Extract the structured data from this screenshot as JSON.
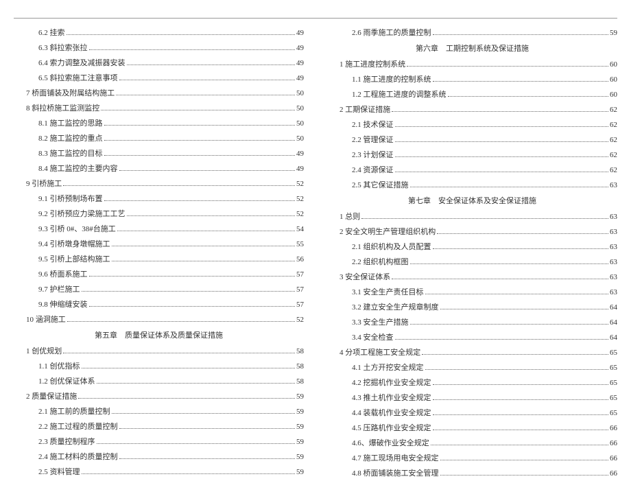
{
  "left": [
    {
      "type": "toc",
      "indent": 1,
      "label": "6.2 挂索",
      "page": 49
    },
    {
      "type": "toc",
      "indent": 1,
      "label": "6.3 斜拉索张拉",
      "page": 49
    },
    {
      "type": "toc",
      "indent": 1,
      "label": "6.4 索力调整及减振器安装",
      "page": 49
    },
    {
      "type": "toc",
      "indent": 1,
      "label": "6.5 斜拉索施工注意事项",
      "page": 49
    },
    {
      "type": "toc",
      "indent": 0,
      "label": "7 桥面铺装及附属结构施工",
      "page": 50
    },
    {
      "type": "toc",
      "indent": 0,
      "label": "8 斜拉桥施工监测监控",
      "page": 50
    },
    {
      "type": "toc",
      "indent": 1,
      "label": "8.1 施工监控的思路",
      "page": 50
    },
    {
      "type": "toc",
      "indent": 1,
      "label": "8.2 施工监控的重点",
      "page": 50
    },
    {
      "type": "toc",
      "indent": 1,
      "label": "8.3 施工监控的目标",
      "page": 49
    },
    {
      "type": "toc",
      "indent": 1,
      "label": "8.4 施工监控的主要内容",
      "page": 49
    },
    {
      "type": "toc",
      "indent": 0,
      "label": "9 引桥施工",
      "page": 52
    },
    {
      "type": "toc",
      "indent": 1,
      "label": "9.1 引桥预制场布置",
      "page": 52
    },
    {
      "type": "toc",
      "indent": 1,
      "label": "9.2 引桥预应力梁施工工艺",
      "page": 52
    },
    {
      "type": "toc",
      "indent": 1,
      "label": "9.3 引桥 0#、38#台施工",
      "page": 54
    },
    {
      "type": "toc",
      "indent": 1,
      "label": "9.4 引桥墩身墩帽施工",
      "page": 55
    },
    {
      "type": "toc",
      "indent": 1,
      "label": "9.5 引桥上部结构施工",
      "page": 56
    },
    {
      "type": "toc",
      "indent": 1,
      "label": "9.6 桥面系施工",
      "page": 57
    },
    {
      "type": "toc",
      "indent": 1,
      "label": "9.7 护栏施工",
      "page": 57
    },
    {
      "type": "toc",
      "indent": 1,
      "label": "9.8 伸缩缝安装",
      "page": 57
    },
    {
      "type": "toc",
      "indent": 0,
      "label": "10 涵洞施工",
      "page": 52
    },
    {
      "type": "chapter",
      "label": "第五章　质量保证体系及质量保证措施"
    },
    {
      "type": "toc",
      "indent": 0,
      "label": "1 创优规划",
      "page": 58
    },
    {
      "type": "toc",
      "indent": 1,
      "label": "1.1 创优指标",
      "page": 58
    },
    {
      "type": "toc",
      "indent": 1,
      "label": "1.2 创优保证体系",
      "page": 58
    },
    {
      "type": "toc",
      "indent": 0,
      "label": "2 质量保证措施",
      "page": 59
    },
    {
      "type": "toc",
      "indent": 1,
      "label": "2.1 施工前的质量控制",
      "page": 59
    },
    {
      "type": "toc",
      "indent": 1,
      "label": "2.2 施工过程的质量控制",
      "page": 59
    },
    {
      "type": "toc",
      "indent": 1,
      "label": "2.3 质量控制程序",
      "page": 59
    },
    {
      "type": "toc",
      "indent": 1,
      "label": "2.4 施工材料的质量控制",
      "page": 59
    },
    {
      "type": "toc",
      "indent": 1,
      "label": "2.5 资料管理",
      "page": 59
    }
  ],
  "right": [
    {
      "type": "toc",
      "indent": 1,
      "label": "2.6 雨季施工的质量控制",
      "page": 59
    },
    {
      "type": "chapter",
      "label": "第六章　工期控制系统及保证措施"
    },
    {
      "type": "toc",
      "indent": 0,
      "label": "1 施工进度控制系统",
      "page": 60
    },
    {
      "type": "toc",
      "indent": 1,
      "label": "1.1 施工进度的控制系统",
      "page": 60
    },
    {
      "type": "toc",
      "indent": 1,
      "label": "1.2 工程施工进度的调整系统",
      "page": 60
    },
    {
      "type": "toc",
      "indent": 0,
      "label": "2 工期保证措施",
      "page": 62
    },
    {
      "type": "toc",
      "indent": 1,
      "label": "2.1 技术保证",
      "page": 62
    },
    {
      "type": "toc",
      "indent": 1,
      "label": "2.2 管理保证",
      "page": 62
    },
    {
      "type": "toc",
      "indent": 1,
      "label": "2.3 计划保证",
      "page": 62
    },
    {
      "type": "toc",
      "indent": 1,
      "label": "2.4 资源保证",
      "page": 62
    },
    {
      "type": "toc",
      "indent": 1,
      "label": "2.5 其它保证措施",
      "page": 63
    },
    {
      "type": "chapter",
      "label": "第七章　安全保证体系及安全保证措施"
    },
    {
      "type": "toc",
      "indent": 0,
      "label": "1 总则",
      "page": 63
    },
    {
      "type": "toc",
      "indent": 0,
      "label": "2 安全文明生产管理组织机构",
      "page": 63
    },
    {
      "type": "toc",
      "indent": 1,
      "label": "2.1 组织机构及人员配置",
      "page": 63
    },
    {
      "type": "toc",
      "indent": 1,
      "label": "2.2 组织机构框图",
      "page": 63
    },
    {
      "type": "toc",
      "indent": 0,
      "label": "3 安全保证体系",
      "page": 63
    },
    {
      "type": "toc",
      "indent": 1,
      "label": "3.1 安全生产责任目标",
      "page": 63
    },
    {
      "type": "toc",
      "indent": 1,
      "label": "3.2 建立安全生产规章制度",
      "page": 64
    },
    {
      "type": "toc",
      "indent": 1,
      "label": "3.3 安全生产措施",
      "page": 64
    },
    {
      "type": "toc",
      "indent": 1,
      "label": "3.4 安全检查",
      "page": 64
    },
    {
      "type": "toc",
      "indent": 0,
      "label": "4 分项工程施工安全规定",
      "page": 65
    },
    {
      "type": "toc",
      "indent": 1,
      "label": "4.1 土方开挖安全规定",
      "page": 65
    },
    {
      "type": "toc",
      "indent": 1,
      "label": "4.2 挖掘机作业安全规定",
      "page": 65
    },
    {
      "type": "toc",
      "indent": 1,
      "label": "4.3 推土机作业安全规定",
      "page": 65
    },
    {
      "type": "toc",
      "indent": 1,
      "label": "4.4 装载机作业安全规定",
      "page": 65
    },
    {
      "type": "toc",
      "indent": 1,
      "label": "4.5 压路机作业安全规定",
      "page": 66
    },
    {
      "type": "toc",
      "indent": 1,
      "label": "4.6、爆破作业安全规定",
      "page": 66
    },
    {
      "type": "toc",
      "indent": 1,
      "label": "4.7 施工现场用电安全规定",
      "page": 66
    },
    {
      "type": "toc",
      "indent": 1,
      "label": "4.8 桥面铺装施工安全管理",
      "page": 66
    }
  ]
}
